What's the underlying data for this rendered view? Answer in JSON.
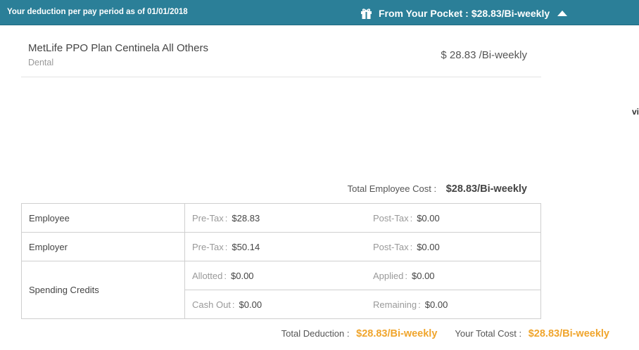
{
  "topbar": {
    "deduction_label": "Your deduction per pay period as of 01/01/2018",
    "pocket_label": "From Your Pocket :",
    "pocket_value": "$28.83/Bi-weekly",
    "pocket_icon": "gift-icon",
    "toggle_icon": "caret-up-icon",
    "bar_color": "#2b7f98"
  },
  "plan": {
    "name": "MetLife PPO Plan Centinela All Others",
    "type": "Dental",
    "cost": "$ 28.83 /Bi-weekly"
  },
  "stray_text": "vi",
  "total_employee": {
    "label": "Total Employee Cost :",
    "value": "$28.83/Bi-weekly"
  },
  "table": {
    "rows": [
      {
        "label": "Employee",
        "mid_label": "Pre-Tax",
        "mid_value": "$28.83",
        "right_label": "Post-Tax",
        "right_value": "$0.00"
      },
      {
        "label": "Employer",
        "mid_label": "Pre-Tax",
        "mid_value": "$50.14",
        "right_label": "Post-Tax",
        "right_value": "$0.00"
      }
    ],
    "credits": {
      "label": "Spending Credits",
      "allotted_label": "Allotted",
      "allotted_value": "$0.00",
      "applied_label": "Applied",
      "applied_value": "$0.00",
      "cashout_label": "Cash Out",
      "cashout_value": "$0.00",
      "remaining_label": "Remaining",
      "remaining_value": "$0.00"
    }
  },
  "footer": {
    "total_deduction_label": "Total Deduction :",
    "total_deduction_value": "$28.83/Bi-weekly",
    "total_cost_label": "Your Total Cost :",
    "total_cost_value": "$28.83/Bi-weekly",
    "accent_color": "#f0a52c"
  }
}
